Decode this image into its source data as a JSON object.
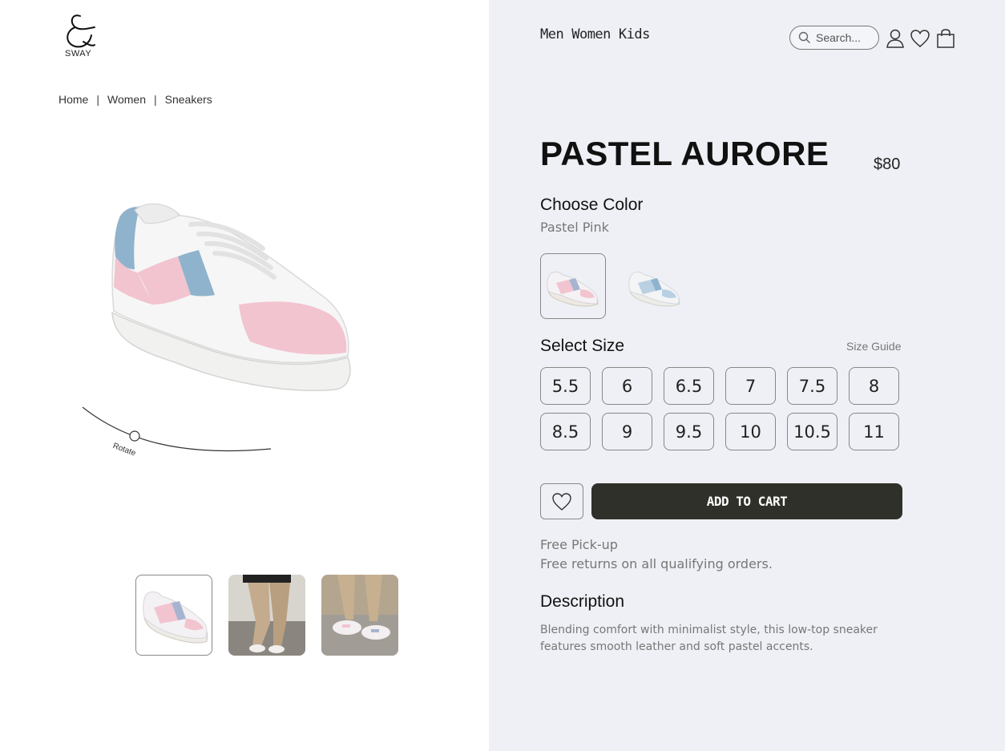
{
  "brand": {
    "logo_text": "SWAY"
  },
  "breadcrumb": [
    "Home",
    "Women",
    "Sneakers"
  ],
  "viewer": {
    "rotate_label": "Rotate"
  },
  "nav": {
    "items": [
      "Men",
      "Women",
      "Kids"
    ]
  },
  "search": {
    "placeholder": "Search..."
  },
  "product": {
    "name": "PASTEL AURORE",
    "price": "$80",
    "choose_color_label": "Choose Color",
    "selected_color": "Pastel Pink",
    "select_size_label": "Select Size",
    "size_guide_label": "Size Guide",
    "sizes": [
      "5.5",
      "6",
      "6.5",
      "7",
      "7.5",
      "8",
      "8.5",
      "9",
      "9.5",
      "10",
      "10.5",
      "11"
    ],
    "add_to_cart_label": "ADD TO CART",
    "shipping": [
      "Free Pick-up",
      "Free returns on all qualifying orders."
    ],
    "description_label": "Description",
    "description": "Blending comfort with minimalist style, this low-top sneaker features smooth leather and soft pastel accents."
  },
  "colors": {
    "right_panel_bg": "#eff0f5",
    "cart_button_bg": "#30302a",
    "accent_pink": "#f2c4d0",
    "accent_blue": "#8fb3cc"
  },
  "icons": [
    "search-icon",
    "user-icon",
    "heart-icon",
    "bag-icon",
    "wishlist-heart-icon"
  ]
}
